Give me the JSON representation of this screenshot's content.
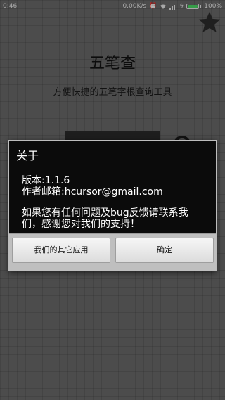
{
  "status_bar": {
    "time": "0:46",
    "net_speed": "0.00K/s",
    "battery_text": "100%",
    "battery_level": 1.0,
    "battery_color": "#4cd964"
  },
  "header": {
    "title": "五笔查",
    "subtitle": "方便快捷的五笔字根查询工具",
    "favorite_icon": "star-icon"
  },
  "search": {
    "icon": "search-icon"
  },
  "dialog": {
    "title": "关于",
    "version": "版本:1.1.6",
    "author_email": "作者邮箱:hcursor@gmail.com",
    "message": "如果您有任何问题及bug反馈请联系我们，感谢您对我们的支持！",
    "buttons": {
      "other_apps": "我们的其它应用",
      "ok": "确定"
    }
  }
}
